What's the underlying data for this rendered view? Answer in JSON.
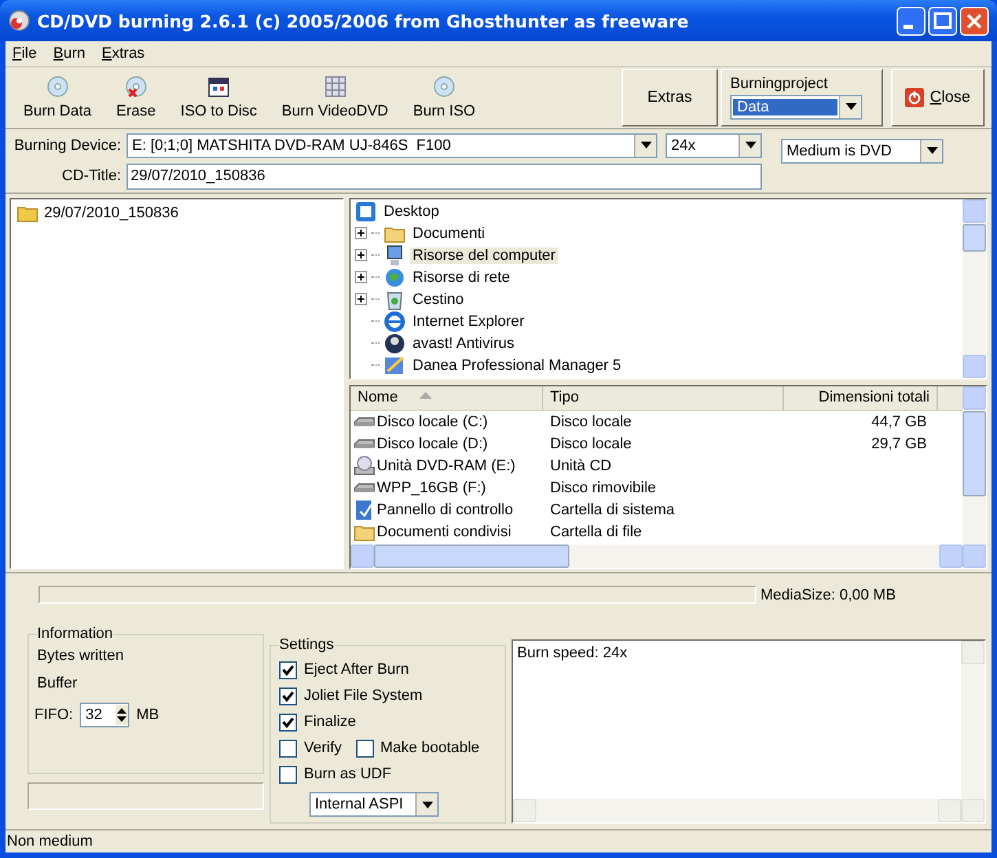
{
  "window": {
    "title": "CD/DVD burning 2.6.1 (c) 2005/2006 from Ghosthunter as freeware"
  },
  "menu": [
    "File",
    "Burn",
    "Extras"
  ],
  "toolbar": [
    {
      "label": "Burn Data",
      "kind": "disc"
    },
    {
      "label": "Erase",
      "kind": "erase"
    },
    {
      "label": "ISO to Disc",
      "kind": "calendar"
    },
    {
      "label": "Burn VideoDVD",
      "kind": "grid"
    },
    {
      "label": "Burn ISO",
      "kind": "disc"
    }
  ],
  "extras_button": "Extras",
  "burning_project": {
    "label": "Burningproject",
    "value": "Data"
  },
  "close_button": "Close",
  "device": {
    "label": "Burning Device:",
    "value": "E: [0;1;0] MATSHITA DVD-RAM UJ-846S  F100"
  },
  "speed": "24x",
  "medium": "Medium is DVD",
  "cd_title": {
    "label": "CD-Title:",
    "value": "29/07/2010_150836"
  },
  "project_tree": [
    "29/07/2010_150836"
  ],
  "folder_tree": {
    "root": "Desktop",
    "children": [
      {
        "label": "Documenti",
        "kind": "docs",
        "expandable": true,
        "selected": false
      },
      {
        "label": "Risorse del computer",
        "kind": "computer",
        "expandable": true,
        "selected": true
      },
      {
        "label": "Risorse di rete",
        "kind": "network",
        "expandable": true,
        "selected": false
      },
      {
        "label": "Cestino",
        "kind": "bin",
        "expandable": true,
        "selected": false
      },
      {
        "label": "Internet Explorer",
        "kind": "browser",
        "expandable": false,
        "selected": false
      },
      {
        "label": "avast! Antivirus",
        "kind": "shield",
        "expandable": false,
        "selected": false
      },
      {
        "label": "Danea Professional Manager 5",
        "kind": "app",
        "expandable": false,
        "selected": false
      }
    ]
  },
  "file_list": {
    "columns": [
      "Nome",
      "Tipo",
      "Dimensioni totali"
    ],
    "rows": [
      {
        "name": "Disco locale (C:)",
        "type": "Disco locale",
        "size": "44,7 GB",
        "kind": "hdd"
      },
      {
        "name": "Disco locale (D:)",
        "type": "Disco locale",
        "size": "29,7 GB",
        "kind": "hdd"
      },
      {
        "name": "Unità DVD-RAM (E:)",
        "type": "Unità CD",
        "kind": "cd"
      },
      {
        "name": "WPP_16GB (F:)",
        "type": "Disco rimovibile",
        "kind": "hdd"
      },
      {
        "name": "Pannello di controllo",
        "type": "Cartella di sistema",
        "kind": "panel"
      },
      {
        "name": "Documenti condivisi",
        "type": "Cartella di file",
        "kind": "folder"
      }
    ]
  },
  "media_progress": {
    "level": 0,
    "label": "MediaSize: 0,00 MB"
  },
  "information": {
    "title": "Information",
    "bytes_written": "Bytes written",
    "buffer": "Buffer",
    "fifo_label": "FIFO:",
    "fifo_value": "32",
    "fifo_unit": "MB"
  },
  "settings": {
    "title": "Settings",
    "rows": [
      [
        {
          "label": "Eject After Burn",
          "checked": true
        }
      ],
      [
        {
          "label": "Joliet File System",
          "checked": true
        }
      ],
      [
        {
          "label": "Finalize",
          "checked": true
        }
      ],
      [
        {
          "label": "Verify",
          "checked": false
        },
        {
          "label": "Make bootable",
          "checked": false
        }
      ],
      [
        {
          "label": "Burn as UDF",
          "checked": false
        }
      ]
    ],
    "interface": "Internal ASPI"
  },
  "log": [
    "Burn speed: 24x"
  ],
  "status_bar": "Non medium"
}
